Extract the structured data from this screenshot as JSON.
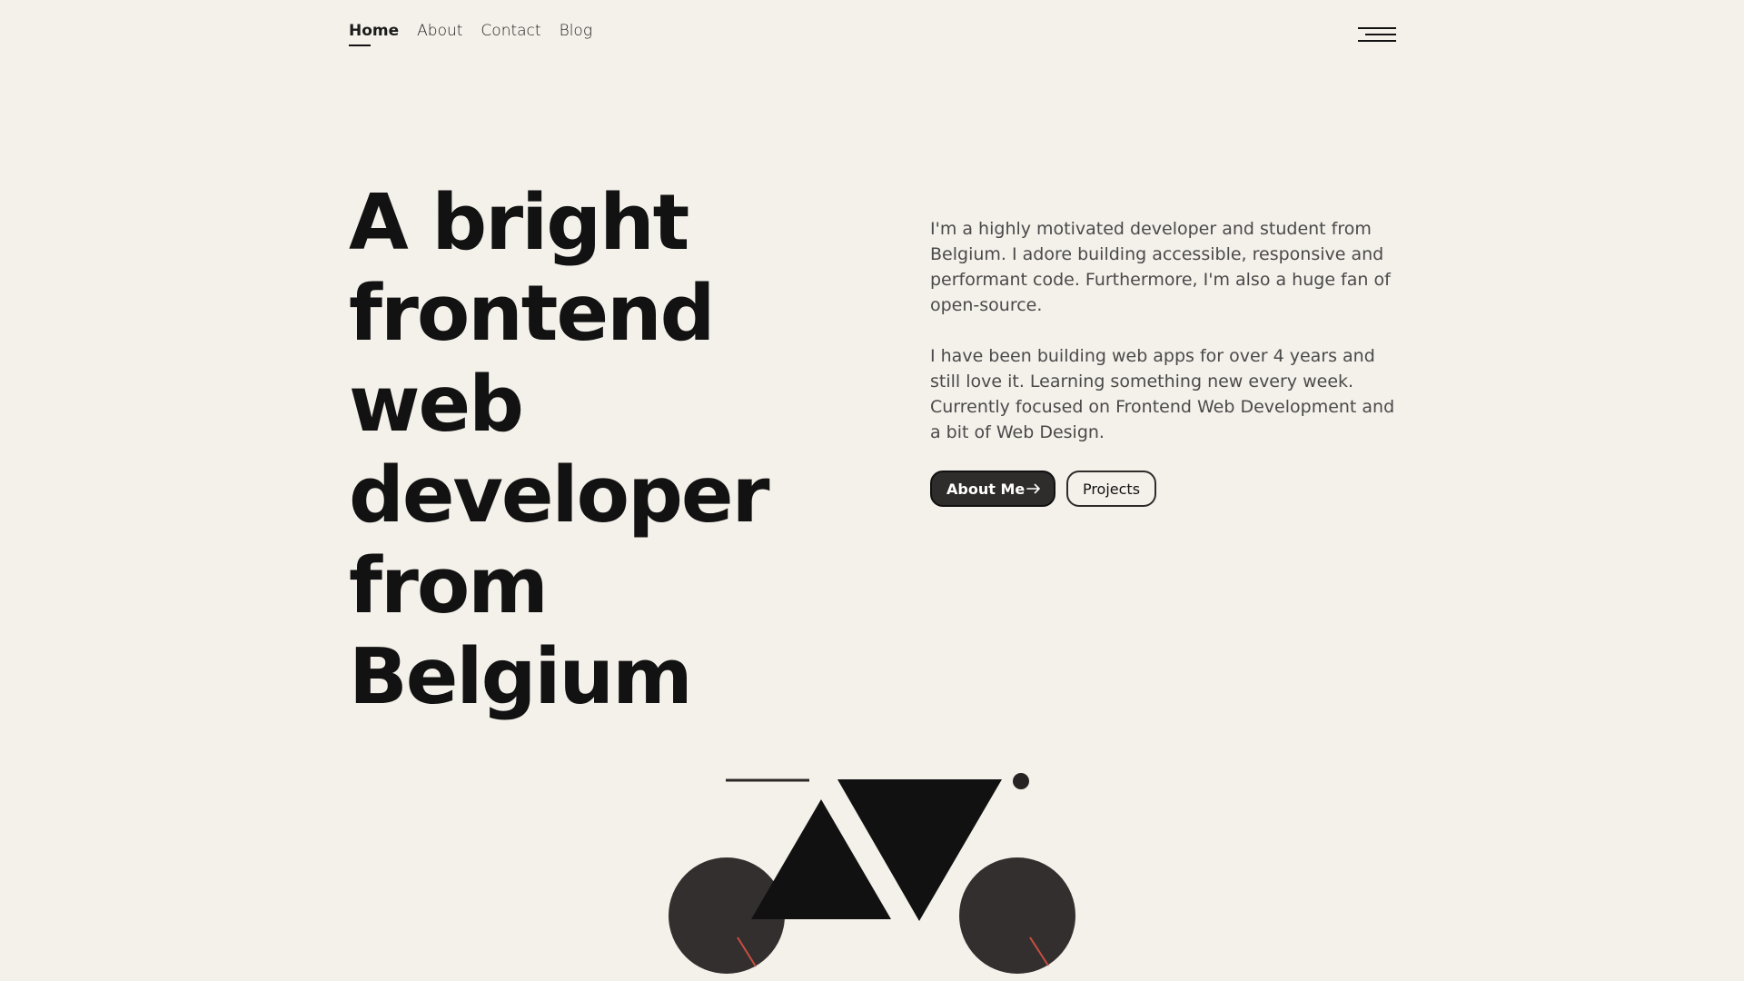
{
  "nav": {
    "items": [
      {
        "label": "Home",
        "active": true
      },
      {
        "label": "About",
        "active": false
      },
      {
        "label": "Contact",
        "active": false
      },
      {
        "label": "Blog",
        "active": false
      }
    ]
  },
  "menu": {
    "icon": "hamburger-menu-icon"
  },
  "hero": {
    "title": "A bright\nfrontend web\ndeveloper\nfrom Belgium",
    "paragraphs": [
      "I'm a highly motivated developer and student from Belgium. I adore building accessible, responsive and performant code. Furthermore, I'm also a huge fan of open-source.",
      "I have been building web apps for over 4 years and still love it. Learning something new every week. Currently focused on Frontend Web Development and a bit of Web Design."
    ],
    "buttons": {
      "primary": {
        "label": "About Me",
        "icon": "arrow-right-icon"
      },
      "secondary": {
        "label": "Projects"
      }
    }
  },
  "colors": {
    "background": "#f4f0ea",
    "text": "#121212",
    "body_text": "#4a4a4a",
    "dark_button": "#2f2c2c",
    "accent": "#c84f3f"
  },
  "illustration": {
    "subject": "abstract geometric bicycle"
  }
}
